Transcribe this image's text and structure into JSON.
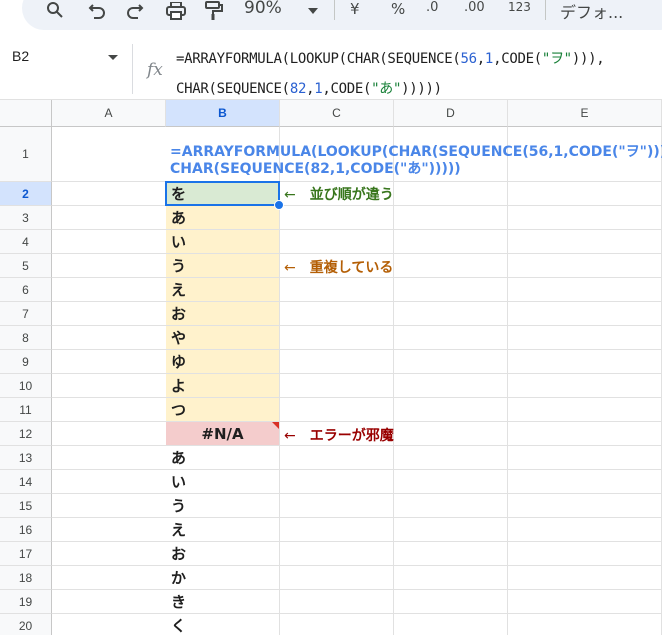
{
  "toolbar": {
    "zoom": "90%",
    "currency": "¥",
    "percent": "%",
    "decimal_decrease": ".0",
    "decimal_increase": ".00",
    "number_format": "123",
    "font": "デフォ..."
  },
  "formula_bar": {
    "name_box": "B2",
    "fx": "fx",
    "line1": {
      "a": "=ARRAYFORMULA(LOOKUP(CHAR(SEQUENCE(",
      "n1": "56",
      "c1": ",",
      "n2": "1",
      "b": ",CODE(",
      "s1": "\"ヲ\"",
      "tail": "))),"
    },
    "line2": {
      "a": "CHAR(SEQUENCE(",
      "n1": "82",
      "c1": ",",
      "n2": "1",
      "b": ",CODE(",
      "s1": "\"あ\"",
      "tail": ")))))"
    }
  },
  "columns": [
    "A",
    "B",
    "C",
    "D",
    "E"
  ],
  "rows": [
    "1",
    "2",
    "3",
    "4",
    "5",
    "6",
    "7",
    "8",
    "9",
    "10",
    "11",
    "12",
    "13",
    "14",
    "15",
    "16",
    "17",
    "18",
    "19",
    "20"
  ],
  "cell_b1": {
    "line1": "=ARRAYFORMULA(LOOKUP(CHAR(SEQUENCE(56,1,CODE(\"ヲ\"))),",
    "line2": "CHAR(SEQUENCE(82,1,CODE(\"あ\")))))"
  },
  "column_b": [
    "を",
    "あ",
    "い",
    "う",
    "え",
    "お",
    "や",
    "ゆ",
    "よ",
    "つ",
    "#N/A",
    "あ",
    "い",
    "う",
    "え",
    "お",
    "か",
    "き",
    "く"
  ],
  "annotations": {
    "order": {
      "arrow": "←",
      "text": "並び順が違う",
      "color": "#38761d"
    },
    "duplicate": {
      "arrow": "←",
      "text": "重複している",
      "color": "#b45f06"
    },
    "error": {
      "arrow": "←",
      "text": "エラーが邪魔",
      "color": "#990000"
    }
  },
  "colors": {
    "selection": "#1a73e8",
    "green_fill": "#d9ead3",
    "yellow_fill": "#fff2cc",
    "red_fill": "#f4cccc",
    "formula_text": "#4a86e8"
  }
}
